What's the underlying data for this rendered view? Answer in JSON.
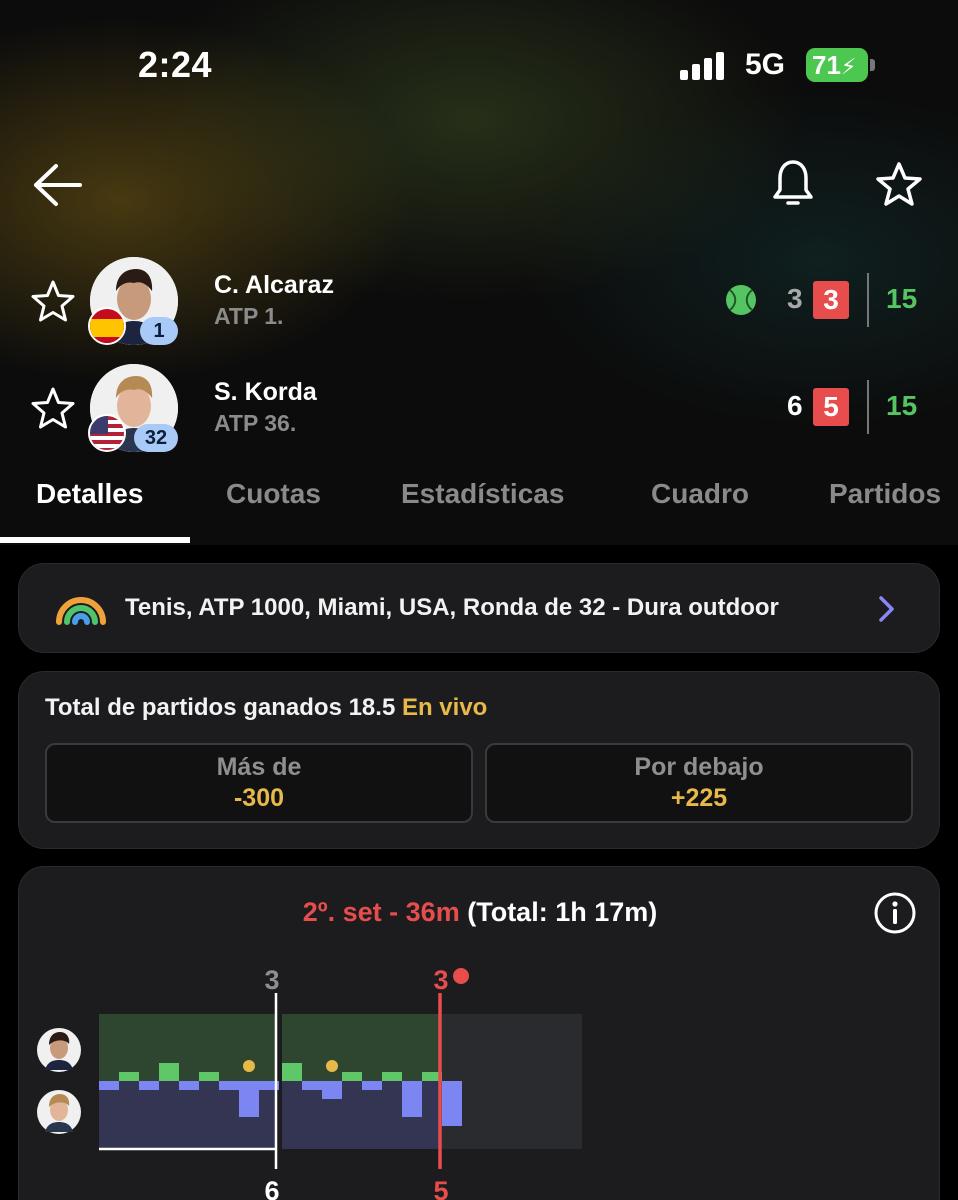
{
  "status_bar": {
    "time": "2:24",
    "network": "5G",
    "battery": "71"
  },
  "nav": {
    "back_icon": "arrow-left-icon",
    "bell_icon": "bell-icon",
    "favorite_icon": "star-icon"
  },
  "match": {
    "players": [
      {
        "name": "C. Alcaraz",
        "rank_text": "ATP 1.",
        "badge": "1",
        "flag": "spain",
        "set1": "3",
        "set2": "3",
        "points": "15",
        "serving": true
      },
      {
        "name": "S. Korda",
        "rank_text": "ATP 36.",
        "badge": "32",
        "flag": "usa",
        "set1": "6",
        "set2": "5",
        "points": "15",
        "serving": false
      }
    ]
  },
  "tabs": [
    "Detalles",
    "Cuotas",
    "Estadísticas",
    "Cuadro",
    "Partidos"
  ],
  "active_tab": "Detalles",
  "tournament": {
    "text": "Tenis, ATP 1000, Miami, USA, Ronda de 32 - Dura outdoor"
  },
  "odds": {
    "title": "Total de partidos ganados 18.5",
    "live": "En vivo",
    "over": {
      "label": "Más de",
      "value": "-300"
    },
    "under": {
      "label": "Por debajo",
      "value": "+225"
    }
  },
  "momentum": {
    "set_text": "2º. set - 36m",
    "total_text": "(Total: 1h 17m)",
    "set1_top_score": "3",
    "set1_bottom_score": "6",
    "set2_top_score": "3",
    "set2_bottom_score": "5",
    "games_set1": [
      -1,
      1,
      -1,
      2,
      -1,
      1,
      -1,
      -4,
      -1
    ],
    "games_set2": [
      2,
      -1,
      -2,
      1,
      -1,
      1,
      -4,
      1,
      -5
    ],
    "break_markers": {
      "set1_game_index": 7,
      "set2_game_index": 2
    },
    "colors": {
      "top_bg": "#2e4530",
      "bottom_bg": "#333553",
      "top_bar": "#5fc767",
      "bottom_bar": "#7b86f2",
      "current": "#e84d4d",
      "ball": "#e7b949"
    }
  },
  "colors": {
    "accent_green": "#55c463",
    "score_red": "#e84d4d",
    "odds_gold": "#e7b949",
    "card_bg": "#1c1c1e"
  }
}
